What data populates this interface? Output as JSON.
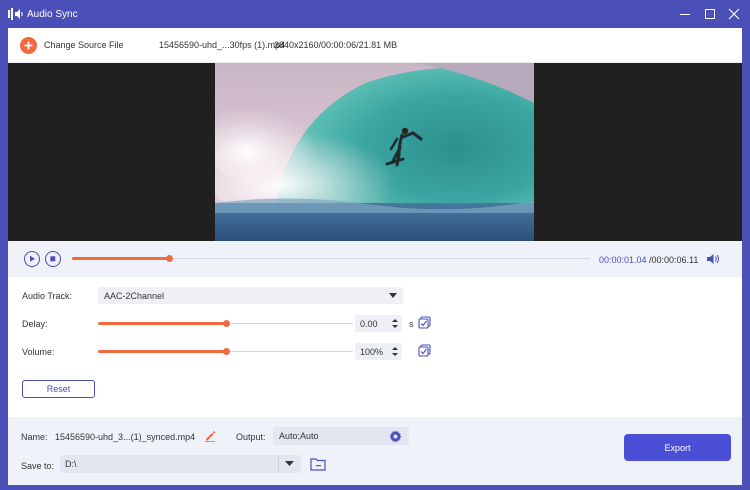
{
  "window": {
    "title": "Audio Sync",
    "icon": "audio-sync-icon",
    "controls": [
      "minimize-icon",
      "maximize-icon",
      "close-icon"
    ]
  },
  "source": {
    "change_label": "Change Source File",
    "file_name": "15456590-uhd_...30fps (1).mp4",
    "file_info": "3840x2160/00:00:06/21.81 MB"
  },
  "playback": {
    "current_time": "00:00:01.04",
    "total_time": "/00:00:06.11",
    "progress": 0.187
  },
  "settings": {
    "audio_track_label": "Audio Track:",
    "audio_track_value": "AAC-2Channel",
    "delay_label": "Delay:",
    "delay_value": "0.00",
    "delay_unit": "s",
    "delay_slider": 0.5,
    "volume_label": "Volume:",
    "volume_value": "100%",
    "volume_slider": 0.5,
    "reset_label": "Reset"
  },
  "footer": {
    "name_label": "Name:",
    "name_value": "15456590-uhd_3...(1)_synced.mp4",
    "output_label": "Output:",
    "output_value": "Auto;Auto",
    "save_label": "Save to:",
    "save_path": "D:\\",
    "export_label": "Export"
  },
  "colors": {
    "accent": "#4b4fb8",
    "orange": "#f16a3d",
    "export": "#4b4fd6",
    "panel": "#f0f2f9"
  }
}
